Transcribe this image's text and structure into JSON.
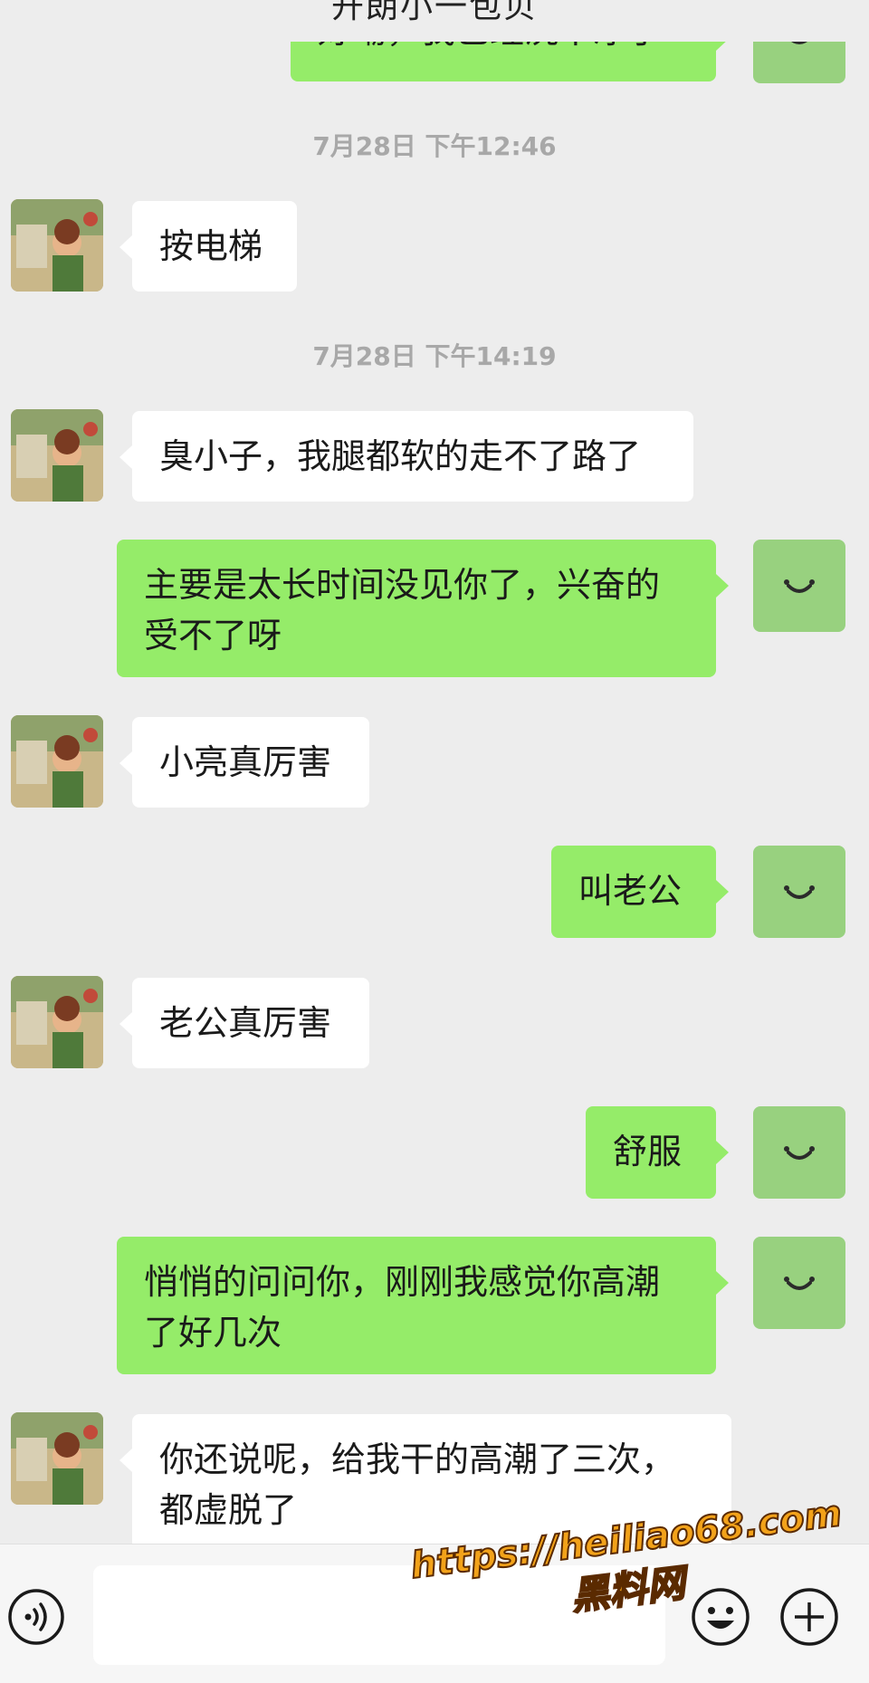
{
  "header": {
    "title": "开朗小一包贝"
  },
  "messages": [
    {
      "type": "sent",
      "text": "好嘞，我已经洗干净了"
    },
    {
      "type": "time",
      "text": "7月28日 下午12:46"
    },
    {
      "type": "received",
      "text": "按电梯"
    },
    {
      "type": "time",
      "text": "7月28日 下午14:19"
    },
    {
      "type": "received",
      "text": "臭小子，我腿都软的走不了路了"
    },
    {
      "type": "sent",
      "text": "主要是太长时间没见你了，兴奋的受不了呀"
    },
    {
      "type": "received",
      "text": "小亮真厉害"
    },
    {
      "type": "sent",
      "text": "叫老公"
    },
    {
      "type": "received",
      "text": "老公真厉害"
    },
    {
      "type": "sent",
      "text": "舒服"
    },
    {
      "type": "sent",
      "text": "悄悄的问问你，刚刚我感觉你高潮了好几次"
    },
    {
      "type": "received",
      "text": "你还说呢，给我干的高潮了三次，都虚脱了"
    }
  ],
  "input_bar": {
    "voice_icon": "voice-icon",
    "emoji_icon": "emoji-icon",
    "plus_icon": "plus-icon",
    "input_value": ""
  },
  "watermark": {
    "url": "https://heiliao68.com",
    "label": "黑料网"
  },
  "colors": {
    "background": "#ededed",
    "sent_bubble": "#95ec69",
    "received_bubble": "#ffffff",
    "my_avatar": "#98d17f",
    "timestamp": "#a8a8a8",
    "watermark": "#f2a21a"
  }
}
